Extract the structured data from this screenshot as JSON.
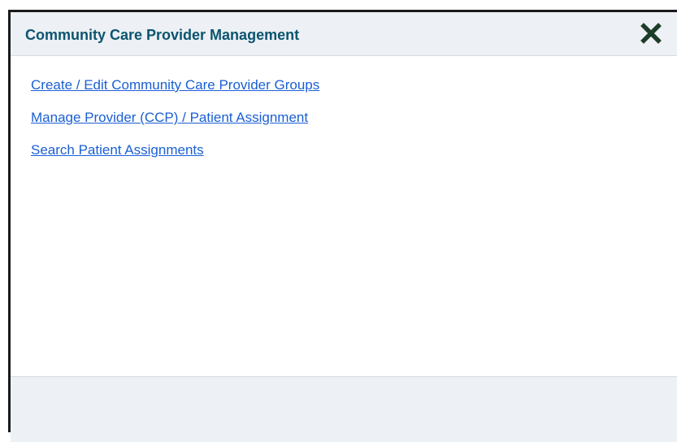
{
  "dialog": {
    "title": "Community Care Provider Management",
    "close_icon": "close-x-icon",
    "title_color": "#0b5470",
    "link_color": "#1a5fd4"
  },
  "links": [
    {
      "label": "Create / Edit Community Care Provider Groups"
    },
    {
      "label": "Manage Provider (CCP) / Patient Assignment"
    },
    {
      "label": "Search Patient Assignments"
    }
  ]
}
